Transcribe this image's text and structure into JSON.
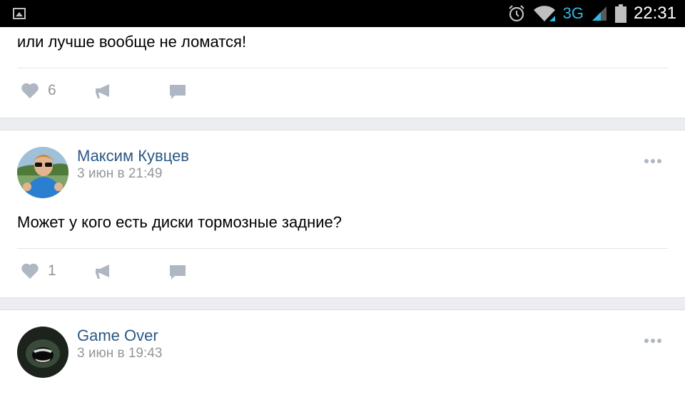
{
  "status_bar": {
    "network": "3G",
    "time": "22:31",
    "icons": [
      "image-notification-icon",
      "alarm-icon",
      "wifi-icon",
      "signal-icon",
      "battery-icon"
    ]
  },
  "posts": [
    {
      "text": "или лучше вообще не ломатся!",
      "likes": "6"
    },
    {
      "author": "Максим Кувцев",
      "date": "3 июн в 21:49",
      "text": "Может у кого есть диски тормозные задние?",
      "likes": "1"
    },
    {
      "author": "Game Over",
      "date": "3 июн в 19:43"
    }
  ],
  "colors": {
    "author_link": "#2a5885",
    "secondary_text": "#939699",
    "icon_gray": "#aeb7c2",
    "feed_background": "#ebedf0"
  }
}
